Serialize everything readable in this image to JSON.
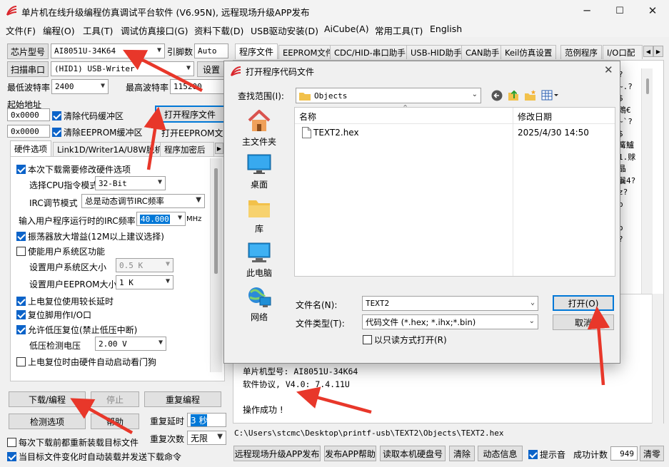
{
  "window": {
    "title": "单片机在线升级编程仿真调试平台软件 (V6.95N), 远程现场升级APP发布",
    "controls": {
      "minimize": "─",
      "maximize": "☐",
      "close": "✕"
    }
  },
  "menu": [
    "文件(F)",
    "编程(O)",
    "工具(T)",
    "调试仿真接口(G)",
    "资料下载(D)",
    "USB驱动安装(D)",
    "AiCube(A)",
    "常用工具(T)",
    "English"
  ],
  "left": {
    "chip_label": "芯片型号",
    "chip_value": "AI8051U-34K64",
    "pins_label": "引脚数",
    "pins_value": "Auto",
    "scan_button": "扫描串口",
    "port_value": "(HID1) USB-Writer",
    "settings_button": "设置",
    "min_baud_label": "最低波特率",
    "min_baud_value": "2400",
    "max_baud_label": "最高波特率",
    "max_baud_value": "115200",
    "start_addr_label": "起始地址",
    "addr1": "0x0000",
    "clear_code_label": "清除代码缓冲区",
    "open_program_button": "打开程序文件",
    "addr2": "0x0000",
    "clear_eeprom_label": "清除EEPROM缓冲区",
    "open_eeprom_button": "打开EEPROM文件",
    "tabs": [
      "硬件选项",
      "Link1D/Writer1A/U8W脱机",
      "程序加密后"
    ],
    "hw": {
      "need_modify": "本次下载需要修改硬件选项",
      "cpu_mode_label": "选择CPU指令模式",
      "cpu_mode_value": "32-Bit",
      "irc_mode_label": "IRC调节模式",
      "irc_mode_value": "总是动态调节IRC频率",
      "irc_freq_label": "输入用户程序运行时的IRC频率",
      "irc_freq_value": "40.000",
      "mhz": "MHz",
      "osc_gain": "振荡器放大增益(12M以上建议选择)",
      "user_sys_enable": "使能用户系统区功能",
      "user_sys_size_label": "设置用户系统区大小",
      "user_sys_size_value": "0.5 K",
      "eeprom_size_label": "设置用户EEPROM大小",
      "eeprom_size_value": "1   K",
      "long_delay": "上电复位使用较长延时",
      "reset_io": "复位脚用作I/O口",
      "low_voltage_reset": "允许低压复位(禁止低压中断)",
      "lv_label": "低压检测电压",
      "lv_value": "2.00 V",
      "watchdog": "上电复位时由硬件自动启动看门狗"
    },
    "download_button": "下载/编程",
    "stop_button": "停止",
    "reprogram_button": "重复编程",
    "detect_button": "检测选项",
    "help_button": "帮助",
    "repeat_delay_label": "重复延时",
    "repeat_delay_value": "3 秒",
    "repeat_count_label": "重复次数",
    "repeat_count_value": "无限",
    "reload_each": "每次下载前都重新装载目标文件",
    "auto_send": "当目标文件变化时自动装载并发送下载命令"
  },
  "right": {
    "tabs": [
      "程序文件",
      "EEPROM文件",
      "CDC/HID-串口助手",
      "USB-HID助手",
      "CAN助手",
      "Keil仿真设置",
      "范例程序",
      "I/O口配"
    ],
    "hex_snippets": [
      "?",
      "~.?",
      "$",
      "鵖€",
      "~`?",
      "$",
      "篝鱸",
      "1.赇",
      "晶",
      "鬤4?",
      "z?",
      "p",
      "",
      "o",
      "?"
    ],
    "log_lines": [
      "单片机型号: AI8051U-34K64",
      "软件协议, V4.0: 7.4.11U",
      "",
      "操作成功 !"
    ],
    "path": "C:\\Users\\stcmc\\Desktop\\printf-usb\\TEXT2\\Objects\\TEXT2.hex",
    "bottom_buttons": [
      "远程现场升级APP发布",
      "发布APP帮助",
      "读取本机硬盘号",
      "清除",
      "动态信息"
    ],
    "beep_label": "提示音",
    "success_label": "成功计数",
    "success_value": "949",
    "clear_count_button": "清零"
  },
  "dialog": {
    "title": "打开程序代码文件",
    "lookin_label": "查找范围(I):",
    "lookin_value": "Objects",
    "places": [
      "主文件夹",
      "桌面",
      "库",
      "此电脑",
      "网络"
    ],
    "col_name": "名称",
    "col_date": "修改日期",
    "files": [
      {
        "name": "TEXT2.hex",
        "date": "2025/4/30 14:50"
      }
    ],
    "filename_label": "文件名(N):",
    "filename_value": "TEXT2",
    "filetype_label": "文件类型(T):",
    "filetype_value": "代码文件 (*.hex; *.ihx;*.bin)",
    "readonly_label": "以只读方式打开(R)",
    "open_button": "打开(O)",
    "cancel_button": "取消"
  },
  "colors": {
    "accent": "#0078d7",
    "arrow": "#e8372a",
    "checkbox": "#0b63c9",
    "folder": "#f2c14b"
  }
}
